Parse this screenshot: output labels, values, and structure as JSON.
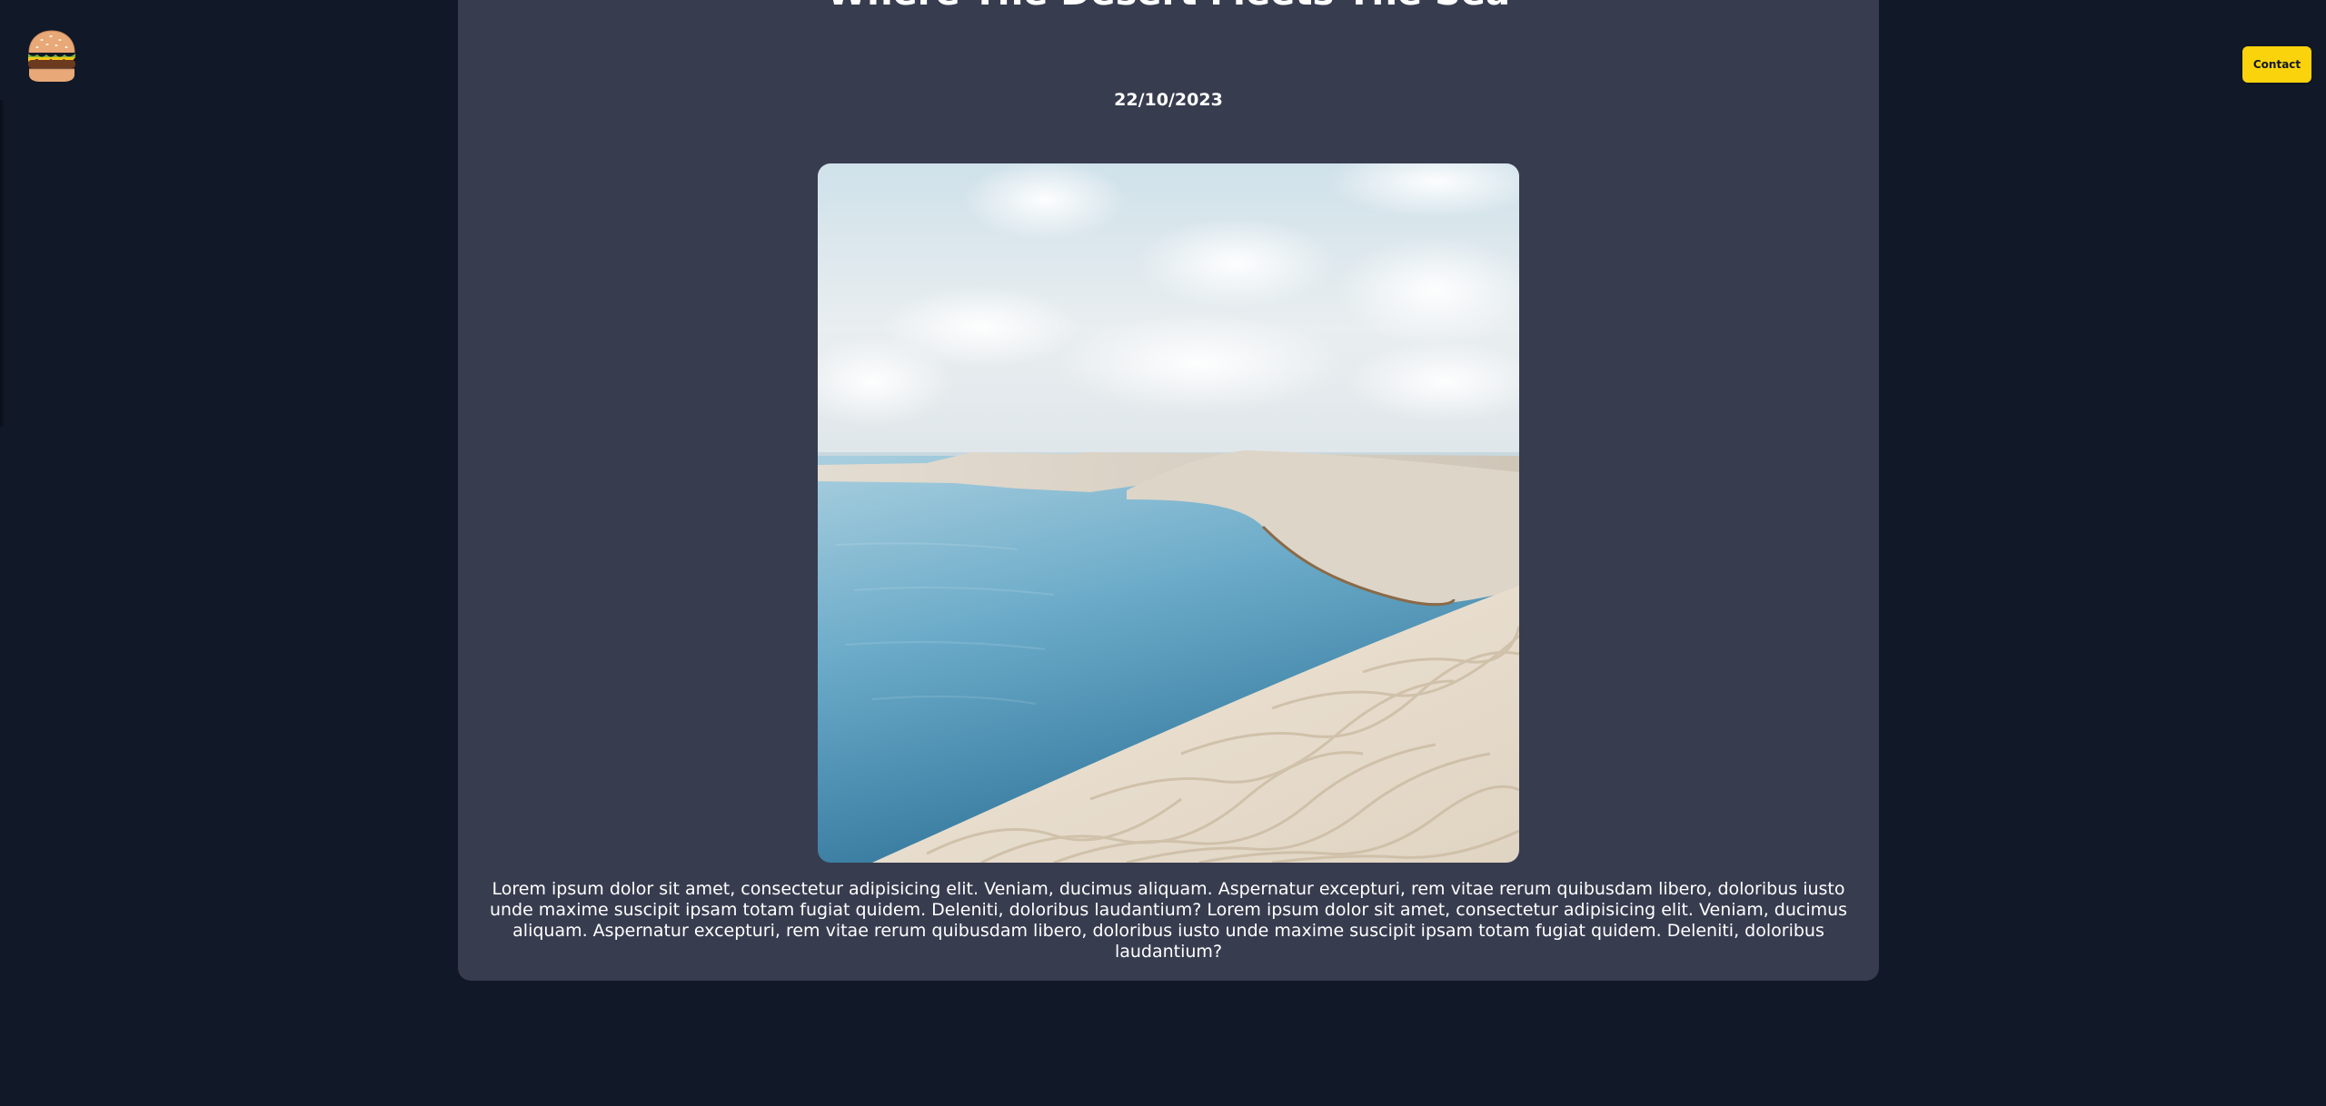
{
  "nav": {
    "menu_icon": "hamburger-burger-icon",
    "contact_label": "Contact"
  },
  "post": {
    "title": "Where The Desert Meets The Sea",
    "date": "22/10/2023",
    "body": "Lorem ipsum dolor sit amet, consectetur adipisicing elit. Veniam, ducimus aliquam. Aspernatur excepturi, rem vitae rerum quibusdam libero, doloribus iusto unde maxime suscipit ipsam totam fugiat quidem. Deleniti, doloribus laudantium? Lorem ipsum dolor sit amet, consectetur adipisicing elit. Veniam, ducimus aliquam. Aspernatur excepturi, rem vitae rerum quibusdam libero, doloribus iusto unde maxime suscipit ipsam totam fugiat quidem. Deleniti, doloribus laudantium?"
  },
  "colors": {
    "page_background": "#111827",
    "card_background": "#383c4f",
    "accent_button": "#fbd30c",
    "text": "#ffffff"
  }
}
